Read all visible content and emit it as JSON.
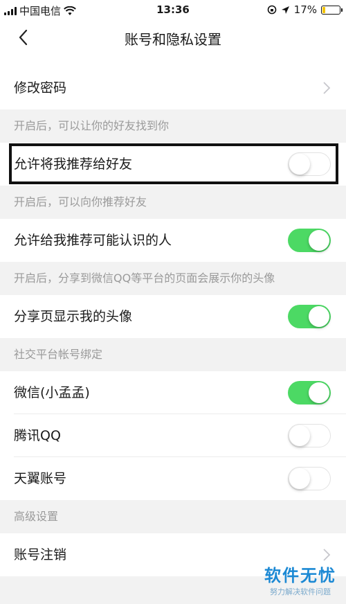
{
  "status_bar": {
    "carrier": "中国电信",
    "time": "13:36",
    "battery": "17%",
    "battery_level": 0.17
  },
  "nav": {
    "title": "账号和隐私设置",
    "back_icon": "chevron-left-icon"
  },
  "rows": {
    "change_password": {
      "label": "修改密码"
    },
    "recommend_me": {
      "label": "允许将我推荐给好友",
      "enabled": false
    },
    "recommend_known": {
      "label": "允许给我推荐可能认识的人",
      "enabled": true
    },
    "show_avatar": {
      "label": "分享页显示我的头像",
      "enabled": true
    },
    "wechat": {
      "label": "微信(小孟孟)",
      "enabled": true
    },
    "tencent_qq": {
      "label": "腾讯QQ",
      "enabled": false
    },
    "tianyi": {
      "label": "天翼账号",
      "enabled": false
    },
    "cancel_account": {
      "label": "账号注销"
    }
  },
  "sections": {
    "find_friends_hint": "开启后，可以让你的好友找到你",
    "recommend_hint": "开启后，可以向你推荐好友",
    "share_hint": "开启后，分享到微信QQ等平台的页面会展示你的头像",
    "social_binding": "社交平台帐号绑定",
    "advanced": "高级设置"
  },
  "watermark": {
    "main": "软件无忧",
    "sub": "努力解决软件问题"
  },
  "colors": {
    "toggle_on": "#4cd964",
    "background": "#f2f2f2",
    "watermark": "#1c89d4"
  }
}
